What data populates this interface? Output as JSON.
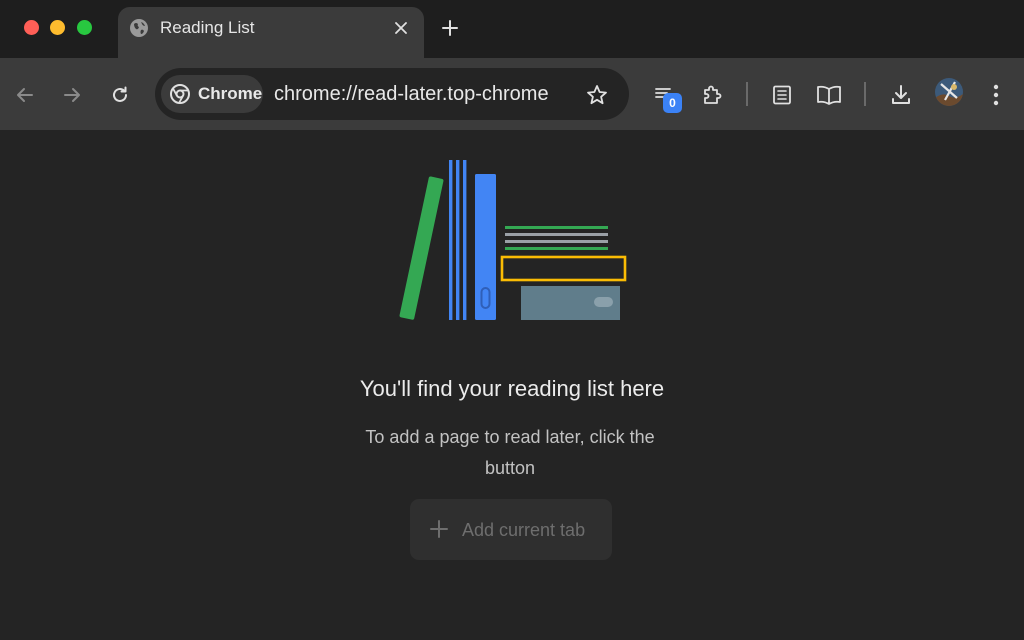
{
  "tab": {
    "title": "Reading List",
    "favicon": "globe-icon"
  },
  "omnibox": {
    "chip_label": "Chrome",
    "url": "chrome://read-later.top-chrome"
  },
  "toolbar": {
    "tab_search_badge": "0"
  },
  "content": {
    "heading": "You'll find your reading list here",
    "subtext": "To add a page to read later, click the button",
    "add_button_label": "Add current tab"
  },
  "colors": {
    "tab_strip": "#1e1e1e",
    "toolbar": "#3b3b3b",
    "page_background": "#242424",
    "badge": "#3b82f6",
    "illustration_green": "#34a853",
    "illustration_blue": "#4285f4",
    "illustration_yellow": "#fbbc04",
    "illustration_slate": "#607d8b"
  }
}
